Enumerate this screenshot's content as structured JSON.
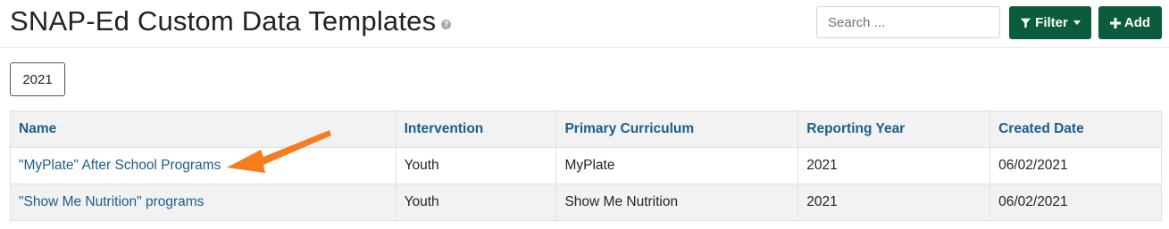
{
  "header": {
    "title": "SNAP-Ed Custom Data Templates",
    "help_icon": "question-circle-icon",
    "search_placeholder": "Search ...",
    "filter_label": "Filter",
    "add_label": "Add"
  },
  "year_filter": {
    "selected": "2021"
  },
  "table": {
    "columns": [
      "Name",
      "Intervention",
      "Primary Curriculum",
      "Reporting Year",
      "Created Date"
    ],
    "rows": [
      {
        "name": "\"MyPlate\" After School Programs",
        "intervention": "Youth",
        "curriculum": "MyPlate",
        "year": "2021",
        "created": "06/02/2021"
      },
      {
        "name": "\"Show Me Nutrition\" programs",
        "intervention": "Youth",
        "curriculum": "Show Me Nutrition",
        "year": "2021",
        "created": "06/02/2021"
      }
    ]
  },
  "colors": {
    "brand_green": "#0a5c3b",
    "link_blue": "#1a5e8c",
    "annotation_arrow": "#f57c1f"
  }
}
